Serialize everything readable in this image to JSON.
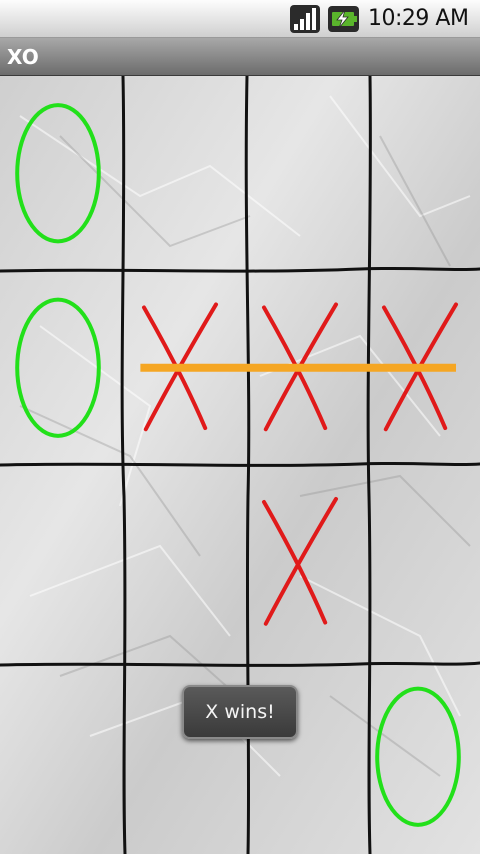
{
  "status_bar": {
    "time": "10:29 AM",
    "signal_icon": "signal-bars-icon",
    "battery_icon": "battery-charging-icon"
  },
  "app": {
    "title": "XO"
  },
  "board": {
    "rows": 4,
    "cols": 4,
    "cells": [
      [
        "O",
        "",
        "",
        ""
      ],
      [
        "O",
        "X",
        "X",
        "X"
      ],
      [
        "",
        "",
        "X",
        ""
      ],
      [
        "",
        "",
        "",
        "O"
      ]
    ],
    "x_color": "#e01a1a",
    "o_color": "#22e01a",
    "win_line_color": "#f5a623",
    "winning_row": 1,
    "paper_color": "#d9d9d9",
    "grid_color": "#111111"
  },
  "toast": {
    "message": "X wins!"
  }
}
